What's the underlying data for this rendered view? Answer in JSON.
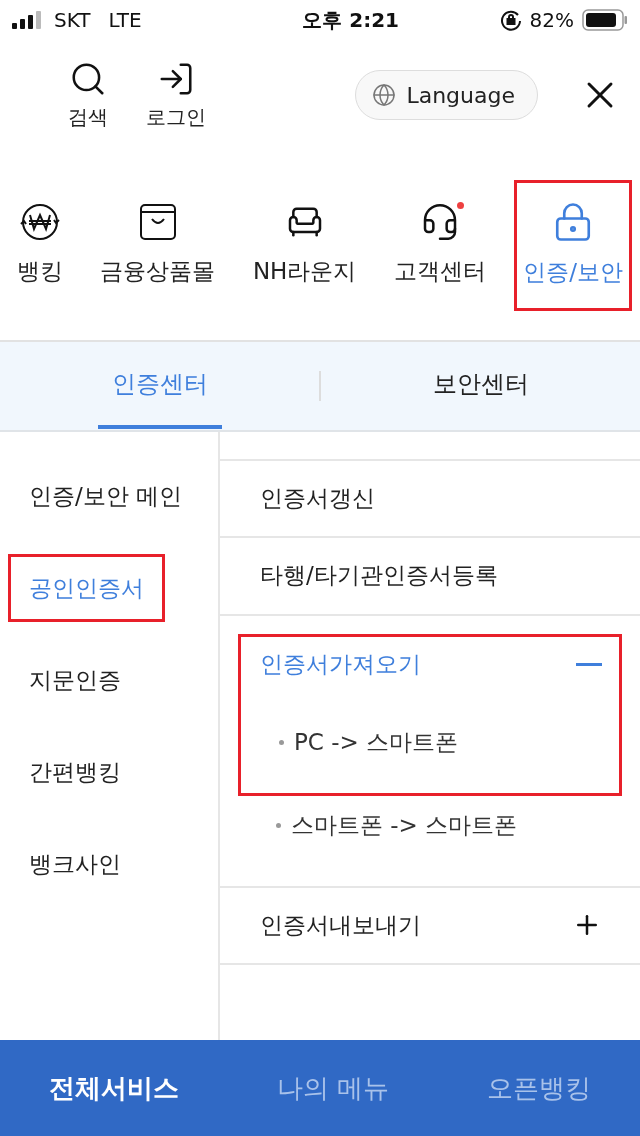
{
  "status_bar": {
    "carrier": "SKT",
    "network": "LTE",
    "time": "오후 2:21",
    "battery": "82%"
  },
  "top_actions": [
    {
      "label": "검색"
    },
    {
      "label": "로그인"
    }
  ],
  "language_button": "Language",
  "categories": [
    {
      "label": "뱅킹",
      "selected": false,
      "badge": false,
      "highlighted": false
    },
    {
      "label": "금융상품몰",
      "selected": false,
      "badge": false,
      "highlighted": false
    },
    {
      "label": "NH라운지",
      "selected": false,
      "badge": false,
      "highlighted": false
    },
    {
      "label": "고객센터",
      "selected": false,
      "badge": true,
      "highlighted": false
    },
    {
      "label": "인증/보안",
      "selected": true,
      "badge": false,
      "highlighted": true
    }
  ],
  "tabs": [
    {
      "label": "인증센터",
      "selected": true
    },
    {
      "label": "보안센터",
      "selected": false
    }
  ],
  "sidebar": {
    "items": [
      {
        "label": "인증/보안 메인",
        "selected": false,
        "highlighted": false
      },
      {
        "label": "공인인증서",
        "selected": true,
        "highlighted": true
      },
      {
        "label": "지문인증",
        "selected": false,
        "highlighted": false
      },
      {
        "label": "간편뱅킹",
        "selected": false,
        "highlighted": false
      },
      {
        "label": "뱅크사인",
        "selected": false,
        "highlighted": false
      }
    ]
  },
  "menu": [
    {
      "label": "인증서갱신",
      "kind": "link"
    },
    {
      "label": "타행/타기관인증서등록",
      "kind": "link"
    },
    {
      "label": "인증서가져오기",
      "kind": "group",
      "expanded": true,
      "highlighted": true,
      "children": [
        {
          "label": "PC -> 스마트폰"
        },
        {
          "label": "스마트폰 -> 스마트폰"
        }
      ]
    },
    {
      "label": "인증서내보내기",
      "kind": "group",
      "expanded": false
    }
  ],
  "bottom_nav": [
    {
      "label": "전체서비스",
      "selected": true
    },
    {
      "label": "나의 메뉴",
      "selected": false
    },
    {
      "label": "오픈뱅킹",
      "selected": false
    }
  ]
}
